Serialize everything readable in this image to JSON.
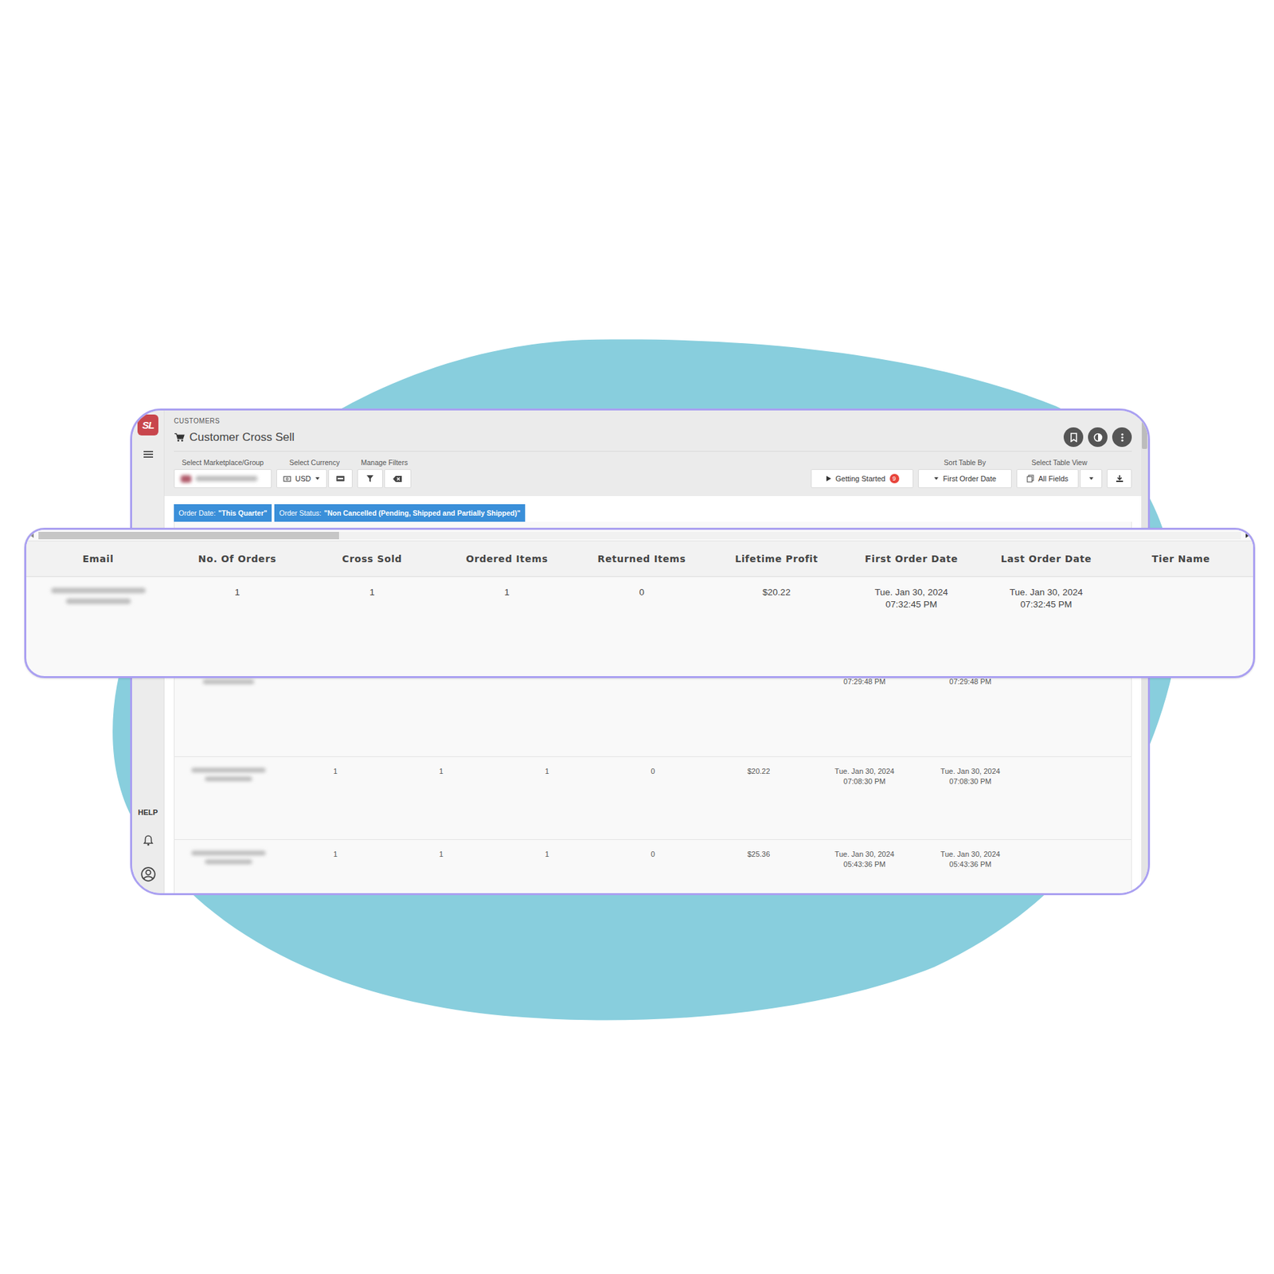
{
  "app": {
    "logo": "SL",
    "breadcrumb": "CUSTOMERS",
    "title": "Customer Cross Sell"
  },
  "sidebar": {
    "help": "HELP"
  },
  "toolbar": {
    "marketplace_label": "Select Marketplace/Group",
    "currency_label": "Select Currency",
    "currency": "USD",
    "filters_label": "Manage Filters",
    "getting_started": "Getting Started",
    "getting_started_badge": "9",
    "sort_label": "Sort Table By",
    "sort_value": "First Order Date",
    "view_label": "Select Table View",
    "view_value": "All Fields"
  },
  "filters": [
    {
      "key": "Order Date:",
      "value": "\"This Quarter\""
    },
    {
      "key": "Order Status:",
      "value": "\"Non Cancelled (Pending, Shipped and Partially Shipped)\""
    }
  ],
  "v_scrollbar": {
    "level": 0.08
  },
  "table": {
    "h_scrollbar": {
      "level": 0.25
    },
    "columns": [
      "Email",
      "No. Of Orders",
      "Cross Sold",
      "Ordered Items",
      "Returned Items",
      "Lifetime Profit",
      "First Order Date",
      "Last Order Date",
      "Tier Name"
    ],
    "rows": [
      {
        "values": [
          "1",
          "1",
          "1",
          "0",
          "$20.22"
        ],
        "first_order": [
          "Tue. Jan 30, 2024",
          "07:32:45 PM"
        ],
        "last_order": [
          "Tue. Jan 30, 2024",
          "07:32:45 PM"
        ]
      }
    ]
  },
  "background_table": {
    "rows": [
      {
        "values": [],
        "first_order": [
          "07:29:48 PM"
        ],
        "last_order": [
          "07:29:48 PM"
        ]
      },
      {
        "values": [
          "1",
          "1",
          "1",
          "0",
          "$20.22"
        ],
        "first_order": [
          "Tue. Jan 30, 2024",
          "07:08:30 PM"
        ],
        "last_order": [
          "Tue. Jan 30, 2024",
          "07:08:30 PM"
        ]
      },
      {
        "values": [
          "1",
          "1",
          "1",
          "0",
          "$25.36"
        ],
        "first_order": [
          "Tue. Jan 30, 2024",
          "05:43:36 PM"
        ],
        "last_order": [
          "Tue. Jan 30, 2024",
          "05:43:36 PM"
        ]
      }
    ]
  }
}
